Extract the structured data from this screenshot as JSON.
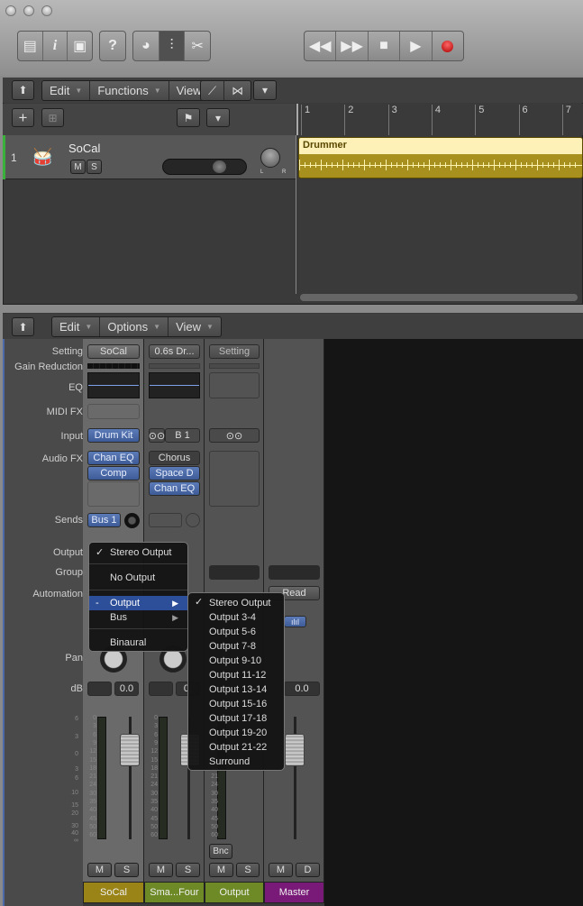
{
  "toolbar": {
    "buttons": [
      "library-icon",
      "info-icon",
      "editor-icon",
      "help-icon",
      "smart-controls-icon",
      "mixer-icon",
      "scissors-icon"
    ],
    "transport": [
      "rewind-icon",
      "forward-icon",
      "stop-icon",
      "play-icon",
      "record-icon"
    ],
    "record_color": "#c01818"
  },
  "tracks": {
    "menu": {
      "edit": "Edit",
      "functions": "Functions",
      "view": "View"
    },
    "ruler": [
      "1",
      "2",
      "3",
      "4",
      "5",
      "6",
      "7"
    ],
    "track": {
      "number": "1",
      "name": "SoCal",
      "mute": "M",
      "solo": "S",
      "pan_l": "L",
      "pan_r": "R",
      "volume": 0.82,
      "color": "#3ab13a"
    },
    "region": {
      "name": "Drummer",
      "color": "#a8901e",
      "header_color": "#fdf1b8"
    }
  },
  "mixer": {
    "menu": {
      "edit": "Edit",
      "options": "Options",
      "view": "View"
    },
    "labels": {
      "setting": "Setting",
      "gain": "Gain Reduction",
      "eq": "EQ",
      "midi": "MIDI FX",
      "input": "Input",
      "audiofx": "Audio FX",
      "sends": "Sends",
      "output": "Output",
      "group": "Group",
      "automation": "Automation",
      "pan": "Pan",
      "db": "dB"
    },
    "master_scale": [
      "6",
      "3",
      "0",
      "3",
      "6",
      "10",
      "15",
      "20",
      "30",
      "40",
      "∞"
    ],
    "meter_scale": [
      "0",
      "3",
      "6",
      "9",
      "12",
      "15",
      "18",
      "21",
      "24",
      "30",
      "35",
      "40",
      "45",
      "50",
      "60"
    ],
    "strips": [
      {
        "name": "SoCal",
        "setting": "SoCal",
        "input": "Drum Kit",
        "fx": [
          "Chan EQ",
          "Comp"
        ],
        "send": "Bus 1",
        "db": "0.0",
        "m": "M",
        "s": "S",
        "color": "#9a8418"
      },
      {
        "name": "Sma...Four",
        "setting": "0.6s Dr...",
        "input": "B 1",
        "fx": [
          "Chorus",
          "Space D",
          "Chan EQ"
        ],
        "db": "0.",
        "m": "M",
        "s": "S",
        "color": "#6e8a26"
      },
      {
        "name": "Output",
        "setting": "Setting",
        "bnc": "Bnc",
        "m": "M",
        "s": "S",
        "color": "#6e8a26"
      },
      {
        "name": "Master",
        "automation": "Read",
        "db": "0.0",
        "m": "M",
        "d": "D",
        "color": "#7a1a78"
      }
    ]
  },
  "output_menu": {
    "items": [
      {
        "label": "Stereo Output",
        "checked": "✓"
      },
      {
        "label": "No Output"
      },
      {
        "label": "Output",
        "mark": "-",
        "arrow": "▶"
      },
      {
        "label": "Bus",
        "arrow": "▶"
      },
      {
        "label": "Binaural"
      }
    ]
  },
  "output_submenu": {
    "check": "✓",
    "items": [
      "Stereo Output",
      "Output 3-4",
      "Output 5-6",
      "Output 7-8",
      "Output 9-10",
      "Output 11-12",
      "Output 13-14",
      "Output 15-16",
      "Output 17-18",
      "Output 19-20",
      "Output 21-22",
      "Surround"
    ]
  }
}
